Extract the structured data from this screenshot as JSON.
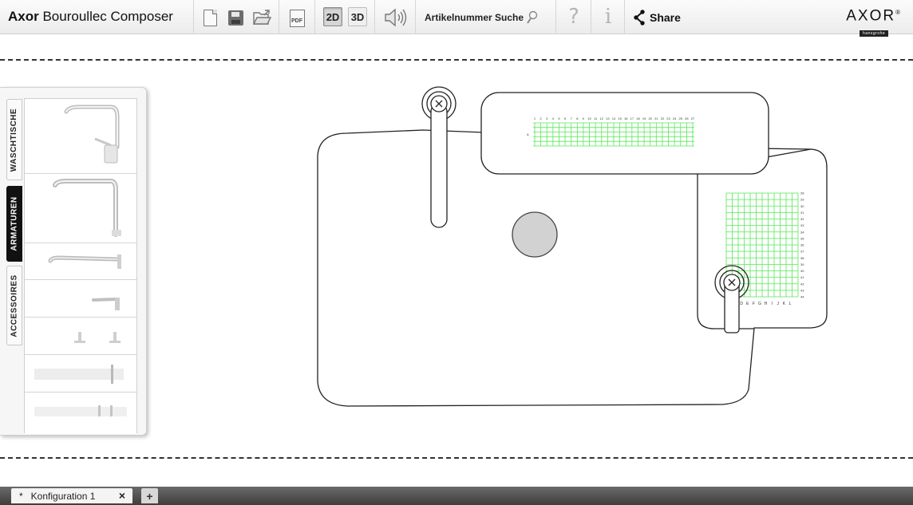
{
  "app": {
    "title_brand": "Axor",
    "title_rest": "Bouroullec Composer"
  },
  "toolbar": {
    "new_icon": "new-document-icon",
    "save_icon": "save-icon",
    "open_icon": "open-folder-icon",
    "pdf_label": "PDF",
    "view_2d": "2D",
    "view_3d": "3D",
    "active_view": "2D",
    "sound_icon": "speaker-icon",
    "search_label": "Artikelnummer Suche",
    "help_glyph": "?",
    "info_glyph": "i",
    "share_label": "Share"
  },
  "brand": {
    "name": "AXOR",
    "registered": "®",
    "tagline": "hansgrohe"
  },
  "side_panel": {
    "tabs": [
      {
        "label": "WASCHTISCHE",
        "active": false
      },
      {
        "label": "ARMATUREN",
        "active": true
      },
      {
        "label": "ACCESSOIRES",
        "active": false
      }
    ]
  },
  "canvas": {
    "top_grid": {
      "row_label": "A",
      "col_labels": [
        "1",
        "2",
        "3",
        "4",
        "5",
        "6",
        "7",
        "8",
        "9",
        "10",
        "11",
        "12",
        "13",
        "14",
        "15",
        "16",
        "17",
        "18",
        "19",
        "20",
        "21",
        "22",
        "23",
        "24",
        "25",
        "26",
        "27"
      ]
    },
    "side_grid": {
      "row_labels": [
        "28",
        "29",
        "30",
        "31",
        "32",
        "33",
        "34",
        "35",
        "36",
        "37",
        "38",
        "39",
        "40",
        "41",
        "42",
        "43",
        "44"
      ],
      "col_labels": [
        "B",
        "C",
        "D",
        "E",
        "F",
        "G",
        "H",
        "I",
        "J",
        "K",
        "L"
      ]
    },
    "marker_glyph": "×"
  },
  "tabs_bar": {
    "tab_star": "*",
    "tab_label": "Konfiguration 1",
    "close_glyph": "×",
    "add_glyph": "+"
  },
  "colors": {
    "grid_green": "#55e855",
    "outline": "#222222",
    "drain_fill": "#d2d2d2",
    "active_tab": "#111111"
  }
}
